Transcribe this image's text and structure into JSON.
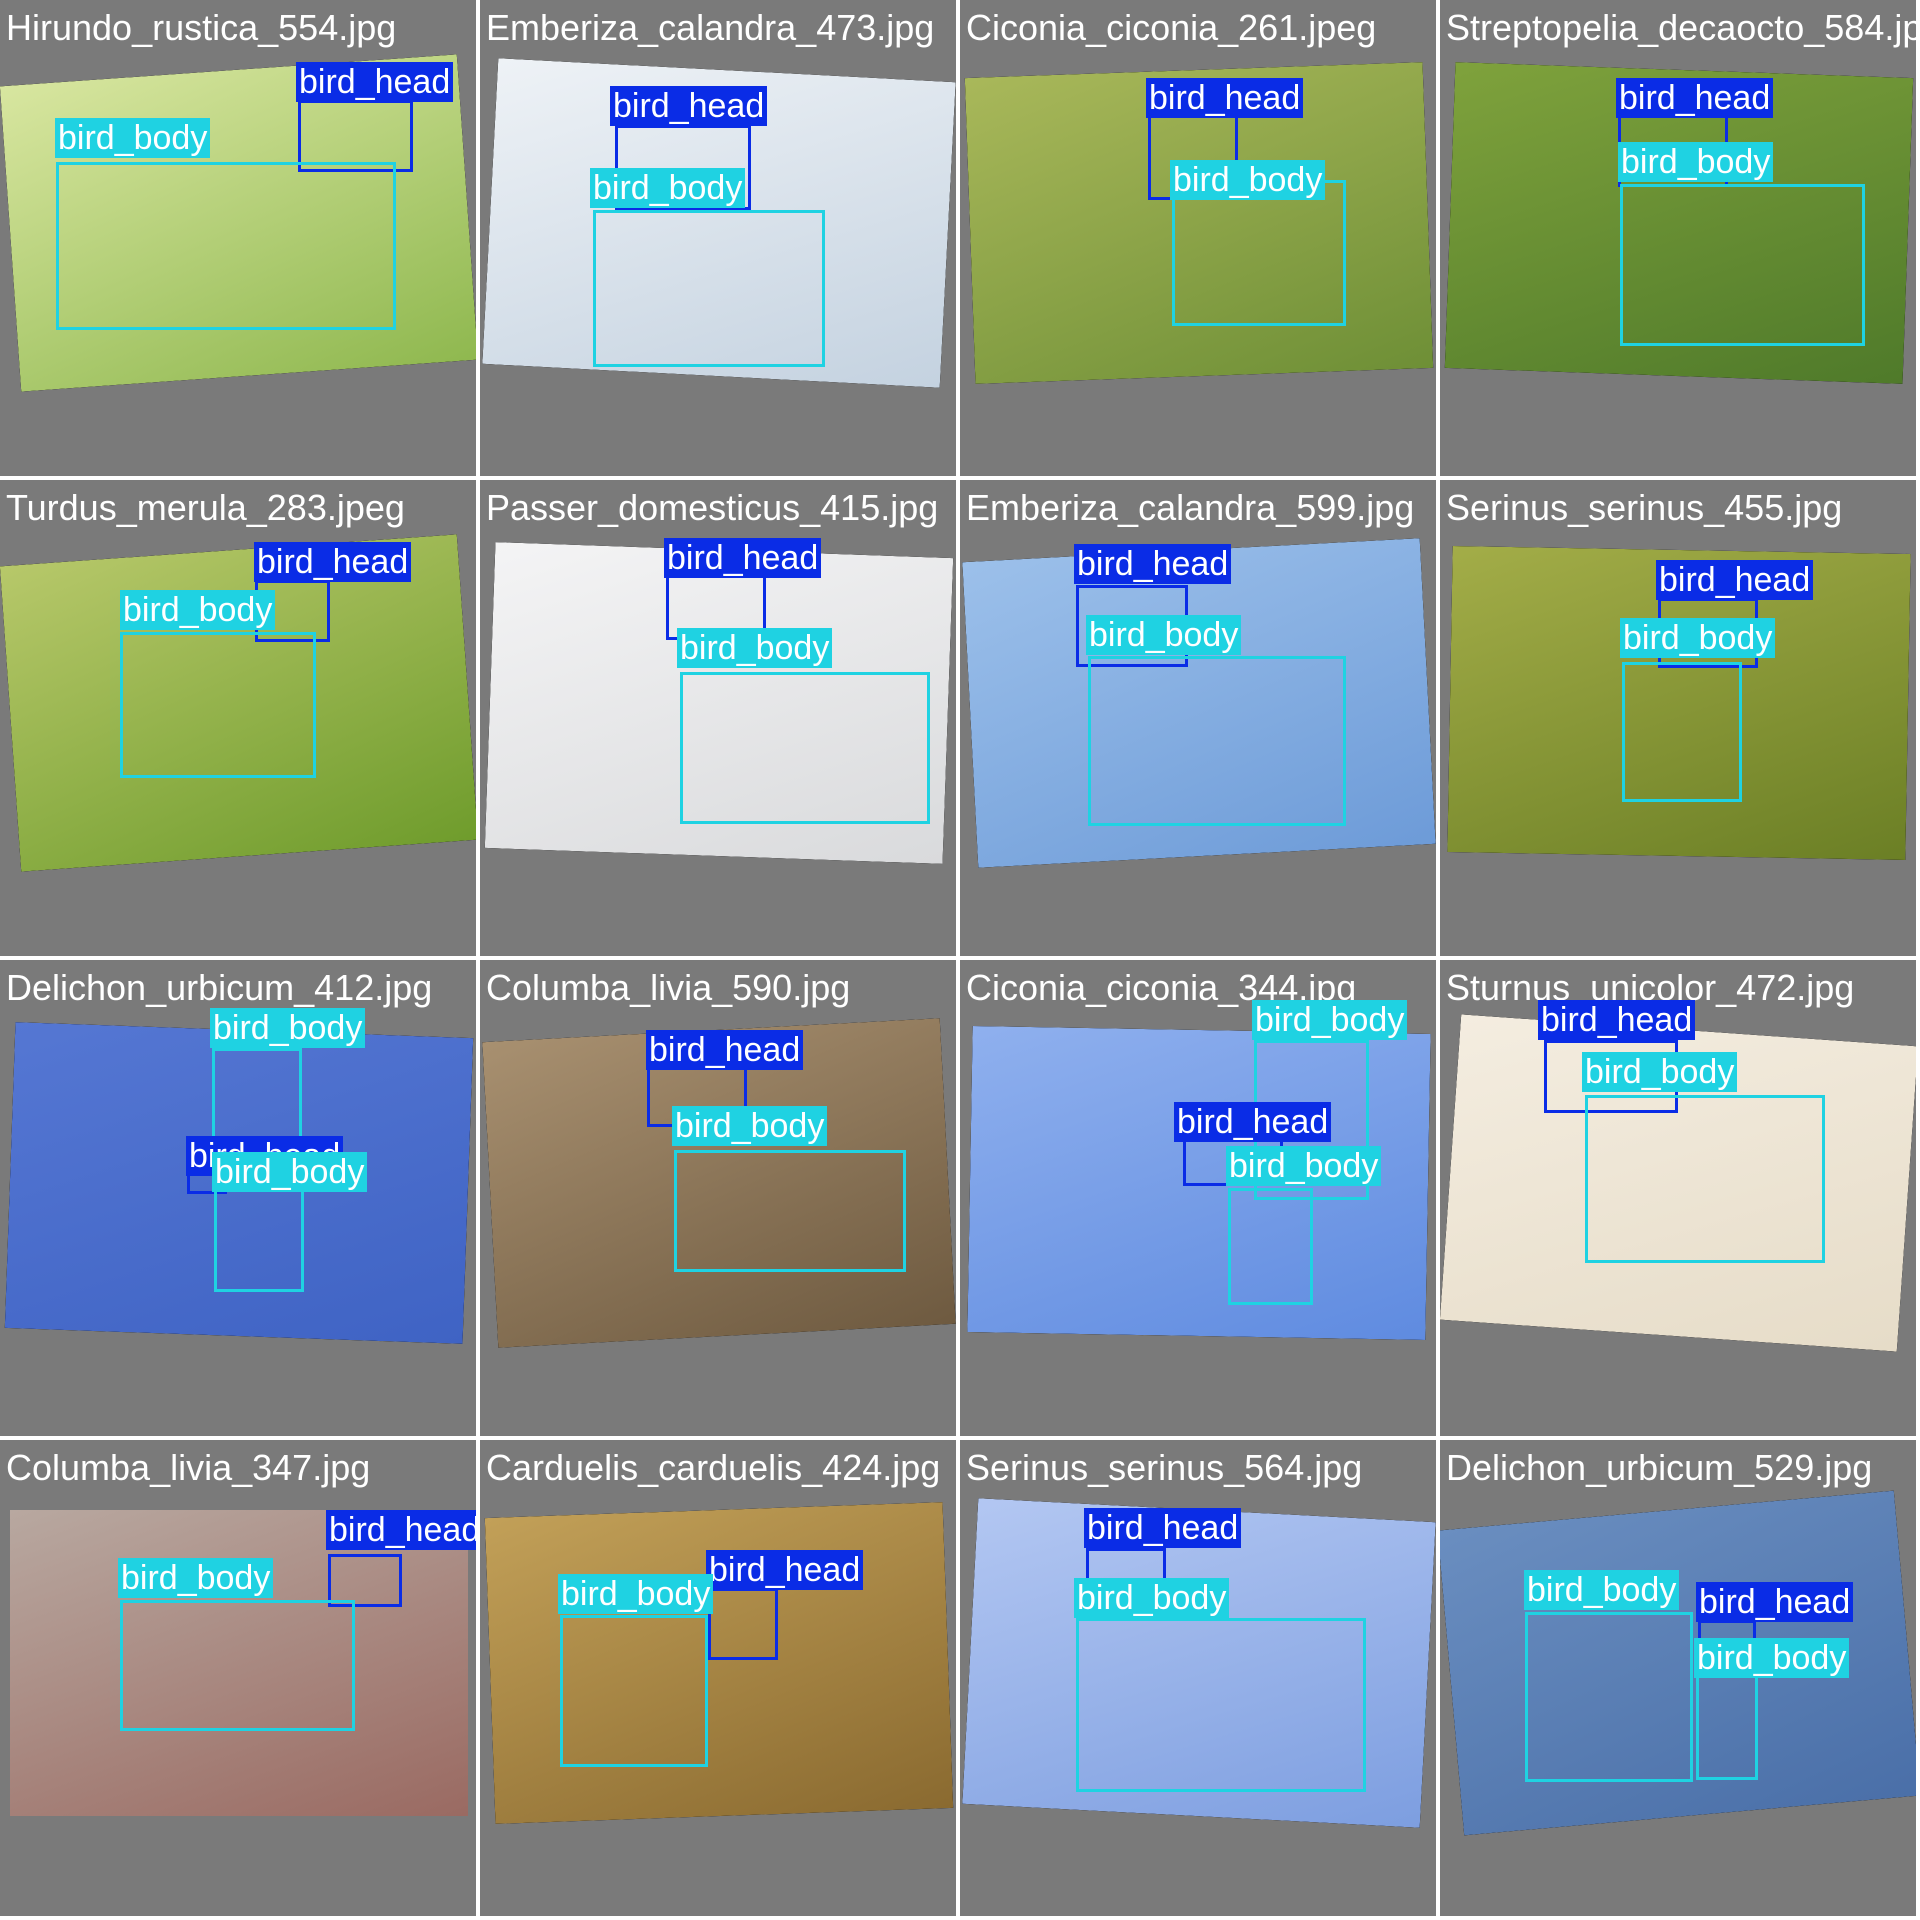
{
  "colors": {
    "tile_background": "#7a7a7a",
    "bird_head": "#0a2ce6",
    "bird_body": "#1fd2e2"
  },
  "labels": {
    "head": "bird_head",
    "body": "bird_body"
  },
  "tiles": [
    {
      "filename": "Hirundo_rustica_554.jpg",
      "scene_colors": [
        "#8fb84f",
        "#d8e6a0"
      ],
      "boxes": [
        "head",
        "body"
      ]
    },
    {
      "filename": "Emberiza_calandra_473.jpg",
      "scene_colors": [
        "#c4d2e0",
        "#eef2f6"
      ],
      "boxes": [
        "head",
        "body"
      ]
    },
    {
      "filename": "Ciconia_ciconia_261.jpeg",
      "scene_colors": [
        "#6e8f36",
        "#a9b85a"
      ],
      "boxes": [
        "head",
        "body"
      ]
    },
    {
      "filename": "Streptopelia_decaocto_584.jpg",
      "scene_colors": [
        "#4f7a2a",
        "#7fa23c"
      ],
      "boxes": [
        "head",
        "body"
      ]
    },
    {
      "filename": "Turdus_merula_283.jpeg",
      "scene_colors": [
        "#6f9c2c",
        "#b7c86a"
      ],
      "boxes": [
        "head",
        "body"
      ]
    },
    {
      "filename": "Passer_domesticus_415.jpg",
      "scene_colors": [
        "#d9dadc",
        "#f4f4f5"
      ],
      "boxes": [
        "head",
        "body"
      ]
    },
    {
      "filename": "Emberiza_calandra_599.jpg",
      "scene_colors": [
        "#6d9bd8",
        "#9cc0ea"
      ],
      "boxes": [
        "head",
        "body"
      ]
    },
    {
      "filename": "Serinus_serinus_455.jpg",
      "scene_colors": [
        "#6b7f25",
        "#a3ad48"
      ],
      "boxes": [
        "head",
        "body"
      ]
    },
    {
      "filename": "Delichon_urbicum_412.jpg",
      "scene_colors": [
        "#3f63c4",
        "#5577d3"
      ],
      "boxes": [
        "body",
        "head",
        "body"
      ]
    },
    {
      "filename": "Columba_livia_590.jpg",
      "scene_colors": [
        "#6e5a40",
        "#a89070"
      ],
      "boxes": [
        "head",
        "body"
      ]
    },
    {
      "filename": "Ciconia_ciconia_344.jpg",
      "scene_colors": [
        "#5f8be0",
        "#8fb0ee"
      ],
      "boxes": [
        "body",
        "head",
        "body"
      ]
    },
    {
      "filename": "Sturnus_unicolor_472.jpg",
      "scene_colors": [
        "#e6dcc8",
        "#f4ede0"
      ],
      "boxes": [
        "head",
        "body"
      ]
    },
    {
      "filename": "Columba_livia_347.jpg",
      "scene_colors": [
        "#9a6a62",
        "#b8a8a0"
      ],
      "boxes": [
        "head",
        "body"
      ]
    },
    {
      "filename": "Carduelis_carduelis_424.jpg",
      "scene_colors": [
        "#8a6a30",
        "#c2a058"
      ],
      "boxes": [
        "head",
        "body"
      ]
    },
    {
      "filename": "Serinus_serinus_564.jpg",
      "scene_colors": [
        "#7d9ee0",
        "#b3c7f2"
      ],
      "boxes": [
        "head",
        "body"
      ]
    },
    {
      "filename": "Delichon_urbicum_529.jpg",
      "scene_colors": [
        "#4a6fa8",
        "#6a8ec0"
      ],
      "boxes": [
        "body",
        "head",
        "body"
      ]
    }
  ]
}
